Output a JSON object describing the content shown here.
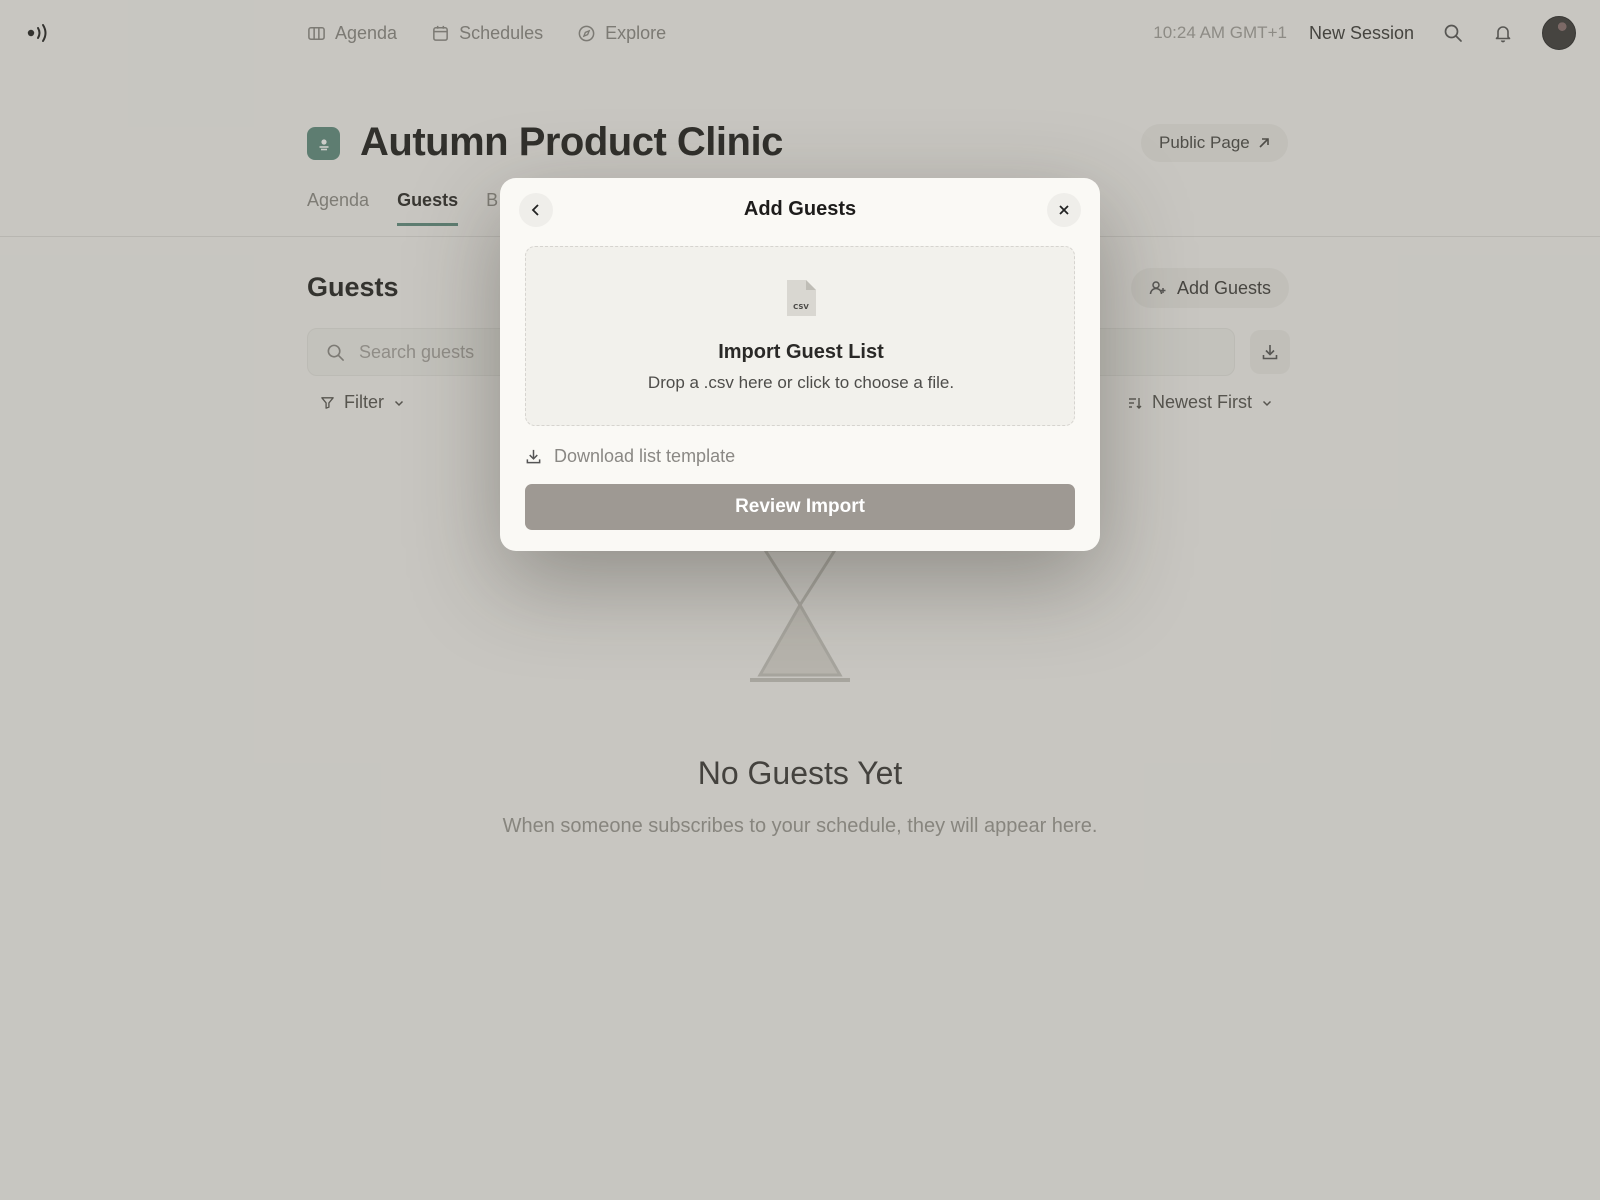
{
  "topbar": {
    "logo_icon": "broadcast-logo-icon",
    "nav": [
      {
        "label": "Agenda",
        "icon": "agenda-icon"
      },
      {
        "label": "Schedules",
        "icon": "calendar-icon"
      },
      {
        "label": "Explore",
        "icon": "compass-icon"
      }
    ],
    "time": "10:24 AM GMT+1",
    "new_session_label": "New Session",
    "search_icon": "search-icon",
    "notification_icon": "bell-icon",
    "avatar_icon": "user-avatar"
  },
  "event": {
    "title": "Autumn Product Clinic",
    "public_page_label": "Public Page",
    "tabs": [
      {
        "label": "Agenda",
        "active": false
      },
      {
        "label": "Guests",
        "active": true
      },
      {
        "label": "B",
        "active": false
      }
    ]
  },
  "guests": {
    "title": "Guests",
    "add_guests_label": "Add Guests",
    "search_placeholder": "Search guests",
    "filter_label": "Filter",
    "sort_label": "Newest First",
    "empty_title": "No Guests Yet",
    "empty_subtitle": "When someone subscribes to your schedule, they will appear here."
  },
  "modal": {
    "title": "Add Guests",
    "file_type": "CSV",
    "drop_title": "Import Guest List",
    "drop_subtitle": "Drop a .csv here or click to choose a file.",
    "download_template_label": "Download list template",
    "review_button_label": "Review Import"
  },
  "colors": {
    "accent": "#5f8d80",
    "overlay": "rgba(92,90,80,0.30)",
    "review_button": "#9e9993",
    "background": "#f6f5f2"
  }
}
